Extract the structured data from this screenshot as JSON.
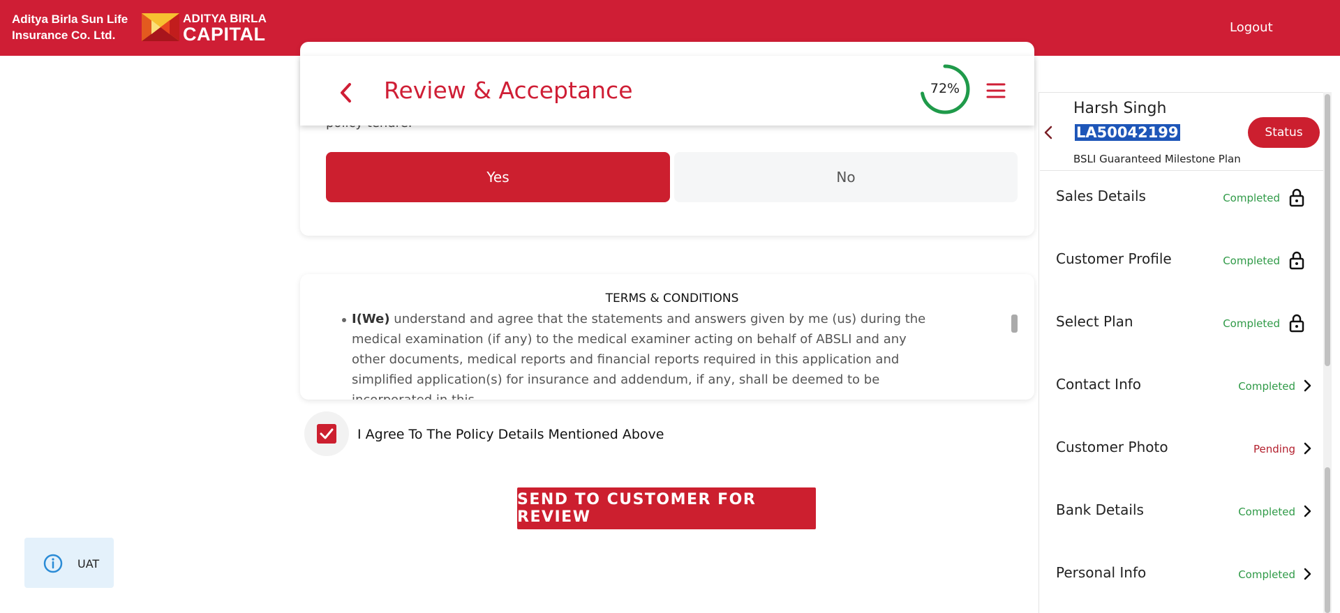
{
  "header": {
    "brand_line1": "Aditya Birla Sun Life",
    "brand_line2": "Insurance Co. Ltd.",
    "logo_line1": "ADITYA BIRLA",
    "logo_line2": "CAPITAL",
    "logout_label": "Logout"
  },
  "review": {
    "partial_text": "policy tenure.",
    "yes_label": "Yes",
    "no_label": "No",
    "title": "Review & Acceptance",
    "progress_text": "72%",
    "progress_value": 72
  },
  "terms": {
    "title": "TERMS & CONDITIONS",
    "bold_prefix": "I(We)",
    "body": " understand and agree that the statements and answers given by me (us) during the medical examination (if any) to the medical examiner acting on behalf of ABSLI and any other documents, medical reports and financial reports required in this application and simplified application(s) for insurance and addendum, if any, shall be deemed to be incorporated in this"
  },
  "agree": {
    "label": "I Agree To The Policy Details Mentioned Above",
    "checked": true
  },
  "send_button_label": "SEND TO CUSTOMER FOR REVIEW",
  "env_badge": "UAT",
  "sidebar": {
    "name": "Harsh Singh",
    "application_id": "LA50042199",
    "plan": "BSLI Guaranteed Milestone Plan",
    "status_label": "Status",
    "items": [
      {
        "label": "Sales Details",
        "state": "Completed",
        "icon": "lock-icon"
      },
      {
        "label": "Customer Profile",
        "state": "Completed",
        "icon": "lock-icon"
      },
      {
        "label": "Select Plan",
        "state": "Completed",
        "icon": "lock-icon"
      },
      {
        "label": "Contact Info",
        "state": "Completed",
        "icon": "chevron-right-icon"
      },
      {
        "label": "Customer Photo",
        "state": "Pending",
        "icon": "chevron-right-icon"
      },
      {
        "label": "Bank Details",
        "state": "Completed",
        "icon": "chevron-right-icon"
      },
      {
        "label": "Personal Info",
        "state": "Completed",
        "icon": "chevron-right-icon"
      }
    ]
  },
  "colors": {
    "brand_red": "#cf1e35",
    "completed_green": "#2f9a47",
    "pending_red": "#b31f2d",
    "progress_green": "#1f9a4a"
  }
}
